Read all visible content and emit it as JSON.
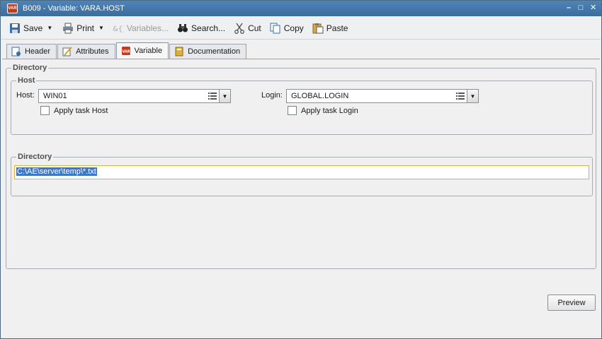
{
  "window": {
    "title": "B009 - Variable: VARA.HOST",
    "icon_text": "VAR",
    "controls": [
      "–",
      "□",
      "✕"
    ]
  },
  "toolbar": {
    "save": "Save",
    "print": "Print",
    "variables": "Variables...",
    "search": "Search...",
    "cut": "Cut",
    "copy": "Copy",
    "paste": "Paste"
  },
  "tabs": [
    {
      "label": "Header",
      "icon": "header-doc-icon"
    },
    {
      "label": "Attributes",
      "icon": "attributes-edit-icon"
    },
    {
      "label": "Variable",
      "icon": "variable-icon",
      "active": true
    },
    {
      "label": "Documentation",
      "icon": "documentation-book-icon"
    }
  ],
  "directory_group": {
    "title": "Directory",
    "host_group": {
      "title": "Host",
      "host_label": "Host:",
      "host_value": "WIN01",
      "login_label": "Login:",
      "login_value": "GLOBAL.LOGIN",
      "apply_host": "Apply task Host",
      "apply_login": "Apply task Login"
    },
    "dir_group": {
      "title": "Directory",
      "value": "C:\\AE\\server\\temp\\*.txt"
    }
  },
  "buttons": {
    "preview": "Preview"
  },
  "colors": {
    "titlebar": "#3b6d9f",
    "selection": "#3b78c9",
    "focus_border": "#e0b040",
    "icon_accent": "#c83a1c"
  }
}
